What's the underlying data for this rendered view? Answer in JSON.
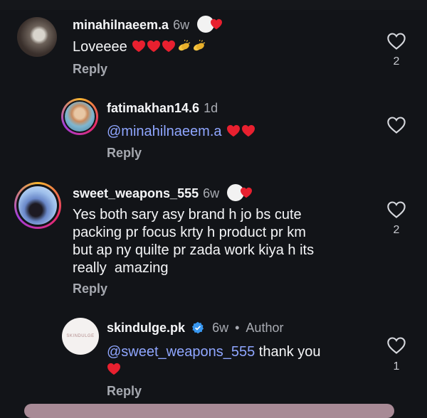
{
  "comments": [
    {
      "username": "minahilnaeem.a",
      "time": "6w",
      "text": "Loveeee",
      "emojis": [
        "red-heart-icon",
        "red-heart-icon",
        "red-heart-icon",
        "clapping-hands-icon",
        "clapping-hands-icon"
      ],
      "reply_label": "Reply",
      "like_count": "2",
      "author_liked": true
    },
    {
      "username": "fatimakhan14.6",
      "time": "1d",
      "mention": "@minahilnaeem.a",
      "emojis": [
        "red-heart-icon",
        "red-heart-icon"
      ],
      "reply_label": "Reply",
      "like_count": ""
    },
    {
      "username": "sweet_weapons_555",
      "time": "6w",
      "lines": [
        "Yes both sary asy brand h jo bs cute",
        "packing pr focus krty h product pr km",
        "but ap ny quilte pr zada work kiya h its",
        "really  amazing"
      ],
      "reply_label": "Reply",
      "like_count": "2",
      "author_liked": true
    },
    {
      "username": "skindulge.pk",
      "verified": true,
      "time": "6w",
      "separator": "•",
      "tag": "Author",
      "mention": "@sweet_weapons_555",
      "text": " thank you",
      "emojis": [
        "red-heart-icon"
      ],
      "reply_label": "Reply",
      "like_count": "1",
      "avatar_text": "SKINDULGE"
    }
  ],
  "colors": {
    "background": "#121418",
    "mention": "#8fa6ff",
    "heart": "#e8202f",
    "secondary_text": "#a6a9b0"
  }
}
